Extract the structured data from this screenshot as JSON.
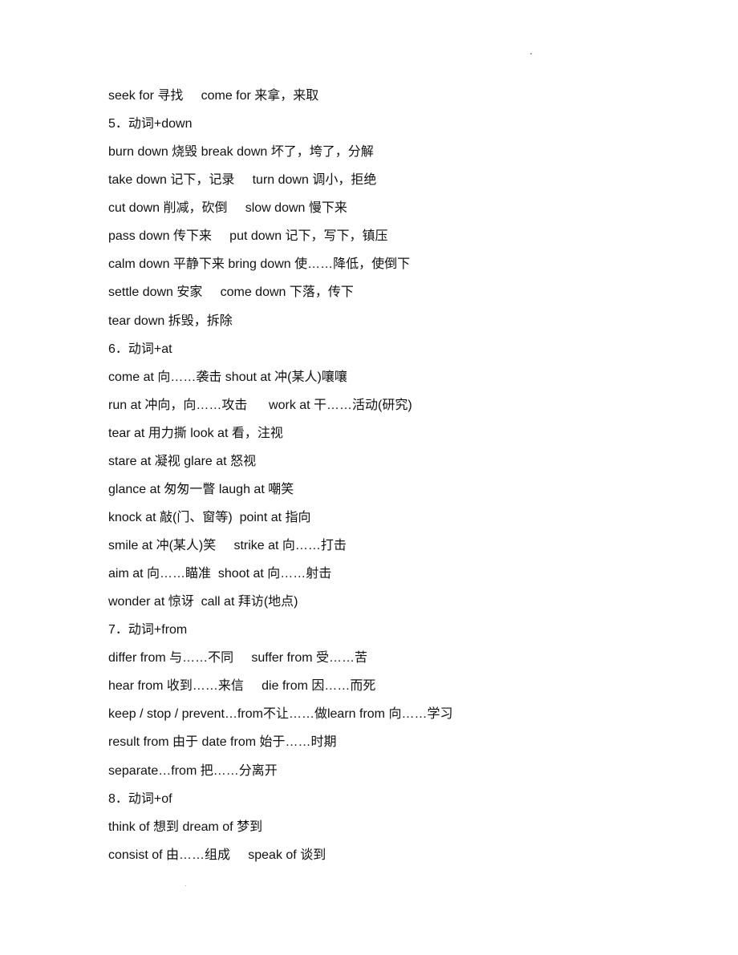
{
  "lines": [
    "seek for 寻找     come for 来拿，来取",
    "5．动词+down",
    "burn down 烧毁 break down 坏了，垮了，分解",
    "take down 记下，记录     turn down 调小，拒绝",
    "cut down 削减，砍倒     slow down 慢下来",
    "pass down 传下来     put down 记下，写下，镇压",
    "calm down 平静下来 bring down 使……降低，使倒下",
    "settle down 安家     come down 下落，传下",
    "tear down 拆毁，拆除",
    "6．动词+at",
    "come at 向……袭击 shout at 冲(某人)嚷嚷",
    "run at 冲向，向……攻击      work at 干……活动(研究)",
    "tear at 用力撕 look at 看，注视",
    "stare at 凝视 glare at 怒视",
    "glance at 匆匆一瞥 laugh at 嘲笑",
    "knock at 敲(门、窗等)  point at 指向",
    "smile at 冲(某人)笑     strike at 向……打击",
    "aim at 向……瞄准  shoot at 向……射击",
    "wonder at 惊讶  call at 拜访(地点)",
    "7．动词+from",
    "differ from 与……不同     suffer from 受……苦",
    "hear from 收到……来信     die from 因……而死",
    "keep / stop / prevent…from不让……做learn from 向……学习",
    "result from 由于 date from 始于……时期",
    "separate…from 把……分离开",
    "8．动词+of",
    "think of 想到 dream of 梦到",
    "consist of 由……组成     speak of 谈到"
  ]
}
